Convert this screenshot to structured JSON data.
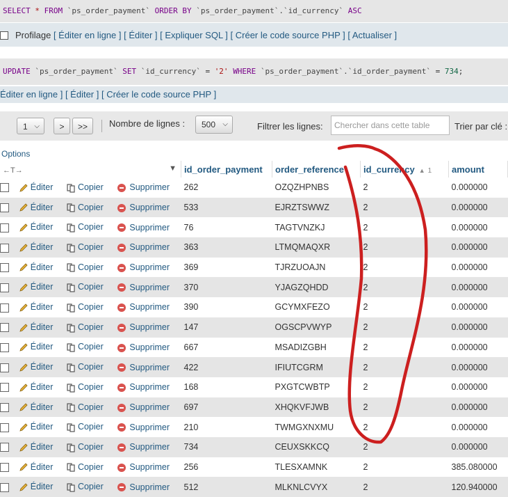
{
  "sql1": {
    "kw1": "SELECT",
    "star": "*",
    "kw2": "FROM",
    "t1": "`ps_order_payment`",
    "kw3": "ORDER BY",
    "t2": "`ps_order_payment`.`id_currency`",
    "kw4": "ASC"
  },
  "links1": {
    "profiling": "Profilage",
    "text": "[ Éditer en ligne ] [ Éditer ] [ Expliquer SQL ] [ Créer le code source PHP ] [ Actualiser ]"
  },
  "sql2": {
    "kw1": "UPDATE",
    "t1": "`ps_order_payment`",
    "kw2": "SET",
    "c1": "`id_currency`",
    "eq": "=",
    "v1": "'2'",
    "kw3": "WHERE",
    "c2": "`ps_order_payment`.`id_order_payment`",
    "eq2": "=",
    "v2": "734",
    "end": ";"
  },
  "links2": {
    "text": "Éditer en ligne ] [ Éditer ] [ Créer le code source PHP ]"
  },
  "nav": {
    "page": "1",
    "next": ">",
    "last": ">>",
    "rows_label": "Nombre de lignes :",
    "rows_value": "500",
    "filter_label": "Filtrer les lignes:",
    "filter_placeholder": "Chercher dans cette table",
    "sort_label": "Trier par clé :"
  },
  "options": "Options",
  "table": {
    "columns": [
      "id_order_payment",
      "order_reference",
      "id_currency",
      "amount"
    ],
    "sort_number": "1",
    "actions": {
      "edit": "Éditer",
      "copy": "Copier",
      "delete": "Supprimer"
    },
    "rows": [
      {
        "id": "262",
        "ref": "OZQZHPNBS",
        "cur": "2",
        "amount": "0.000000"
      },
      {
        "id": "533",
        "ref": "EJRZTSWWZ",
        "cur": "2",
        "amount": "0.000000"
      },
      {
        "id": "76",
        "ref": "TAGTVNZKJ",
        "cur": "2",
        "amount": "0.000000"
      },
      {
        "id": "363",
        "ref": "LTMQMAQXR",
        "cur": "2",
        "amount": "0.000000"
      },
      {
        "id": "369",
        "ref": "TJRZUOAJN",
        "cur": "2",
        "amount": "0.000000"
      },
      {
        "id": "370",
        "ref": "YJAGZQHDD",
        "cur": "2",
        "amount": "0.000000"
      },
      {
        "id": "390",
        "ref": "GCYMXFEZO",
        "cur": "2",
        "amount": "0.000000"
      },
      {
        "id": "147",
        "ref": "OGSCPVWYP",
        "cur": "2",
        "amount": "0.000000"
      },
      {
        "id": "667",
        "ref": "MSADIZGBH",
        "cur": "2",
        "amount": "0.000000"
      },
      {
        "id": "422",
        "ref": "IFIUTCGRM",
        "cur": "2",
        "amount": "0.000000"
      },
      {
        "id": "168",
        "ref": "PXGTCWBTP",
        "cur": "2",
        "amount": "0.000000"
      },
      {
        "id": "697",
        "ref": "XHQKVFJWB",
        "cur": "2",
        "amount": "0.000000"
      },
      {
        "id": "210",
        "ref": "TWMGXNXMU",
        "cur": "2",
        "amount": "0.000000"
      },
      {
        "id": "734",
        "ref": "CEUXSKKCQ",
        "cur": "2",
        "amount": "0.000000"
      },
      {
        "id": "256",
        "ref": "TLESXAMNK",
        "cur": "2",
        "amount": "385.080000"
      },
      {
        "id": "512",
        "ref": "MLKNLCVYX",
        "cur": "2",
        "amount": "120.940000"
      }
    ]
  },
  "colors": {
    "link": "#235a81",
    "annotation": "#cc1f1f",
    "row_alt": "#e5e5e5"
  },
  "icons": {
    "edit": "pencil-icon",
    "copy": "copy-icon",
    "delete": "delete-icon"
  }
}
